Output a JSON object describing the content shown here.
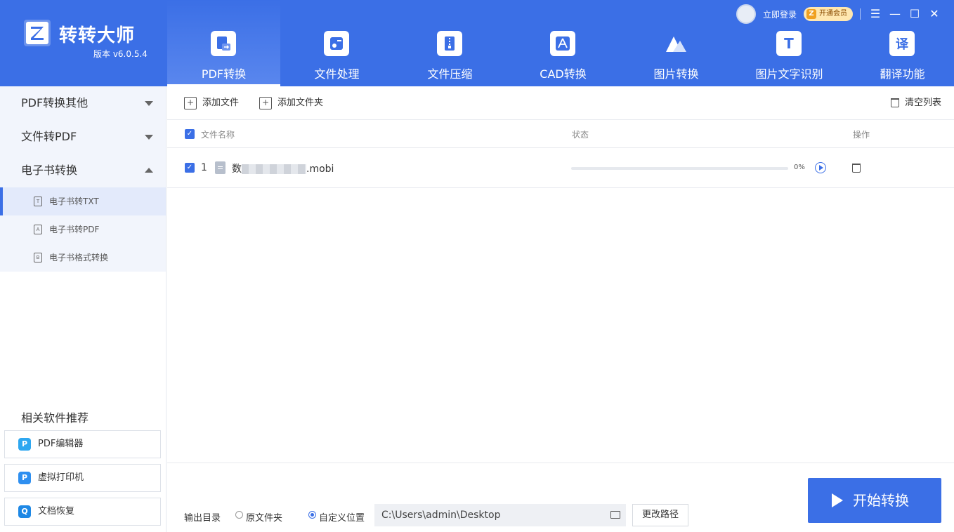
{
  "app": {
    "name": "转转大师",
    "version": "版本 v6.0.5.4",
    "login": "立即登录",
    "vip": "开通会员"
  },
  "colors": {
    "brand": "#3b6fe6",
    "sidebar_bg": "#f2f5fc"
  },
  "nav": [
    {
      "label": "PDF转换",
      "icon": "pdf-convert-icon"
    },
    {
      "label": "文件处理",
      "icon": "file-process-icon"
    },
    {
      "label": "文件压缩",
      "icon": "file-zip-icon"
    },
    {
      "label": "CAD转换",
      "icon": "cad-icon"
    },
    {
      "label": "图片转换",
      "icon": "image-icon"
    },
    {
      "label": "图片文字识别",
      "icon": "ocr-icon"
    },
    {
      "label": "翻译功能",
      "icon": "translate-icon"
    }
  ],
  "nav_icon_glyphs": {
    "ocr": "T",
    "translate": "译"
  },
  "sidebar": {
    "groups": [
      {
        "label": "PDF转换其他"
      },
      {
        "label": "文件转PDF"
      },
      {
        "label": "电子书转换"
      }
    ],
    "sub_items": [
      {
        "label": "电子书转TXT",
        "icon_glyph": "T"
      },
      {
        "label": "电子书转PDF",
        "icon_glyph": "A"
      },
      {
        "label": "电子书格式转换",
        "icon_glyph": "B"
      }
    ],
    "recommend_title": "相关软件推荐",
    "recommend": [
      {
        "label": "PDF编辑器",
        "icon_glyph": "P"
      },
      {
        "label": "虚拟打印机",
        "icon_glyph": "P"
      },
      {
        "label": "文档恢复",
        "icon_glyph": "Q"
      }
    ]
  },
  "toolbar": {
    "add_file": "添加文件",
    "add_folder": "添加文件夹",
    "clear_list": "清空列表"
  },
  "table": {
    "col_name": "文件名称",
    "col_status": "状态",
    "col_action": "操作",
    "rows": [
      {
        "index": "1",
        "name_prefix": "数",
        "name_suffix": ".mobi",
        "progress": "0%",
        "progress_value": 0
      }
    ]
  },
  "output": {
    "label": "输出目录",
    "option_original": "原文件夹",
    "option_custom": "自定义位置",
    "path": "C:\\Users\\admin\\Desktop",
    "change_btn": "更改路径"
  },
  "start_button": "开始转换"
}
